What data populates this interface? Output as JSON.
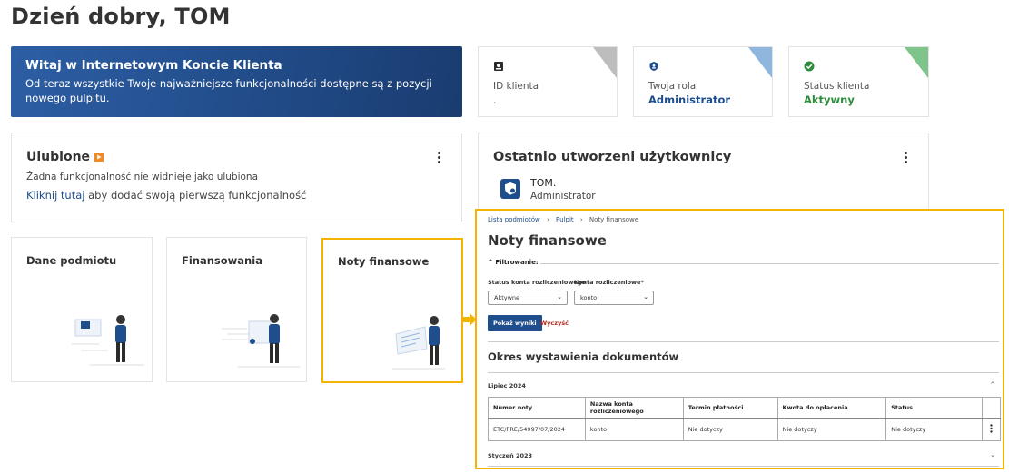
{
  "greeting": "Dzień dobry, TOM",
  "banner": {
    "title": "Witaj w Internetowym Koncie Klienta",
    "text": "Od teraz wszystkie Twoje najważniejsze funkcjonalności dostępne są z pozycji nowego pulpitu."
  },
  "stats": [
    {
      "label": "ID klienta",
      "value": ".",
      "icon": "badge-icon",
      "accent": "#bdbdbd"
    },
    {
      "label": "Twoja rola",
      "value": "Administrator",
      "icon": "shield-user-icon",
      "accent": "#8fb6dc",
      "value_color": "#1f4e8c"
    },
    {
      "label": "Status klienta",
      "value": "Aktywny",
      "icon": "check-circle-icon",
      "accent": "#7fc48a",
      "value_color": "#2e8b3d"
    }
  ],
  "favorites": {
    "title": "Ulubione",
    "empty_text": "Żadna funkcjonalność nie widnieje jako ulubiona",
    "link": "Kliknij tutaj",
    "link_suffix": " aby dodać swoją pierwszą funkcjonalność"
  },
  "recent_users": {
    "title": "Ostatnio utworzeni użytkownicy",
    "name": "TOM.",
    "role": "Administrator"
  },
  "tiles": [
    {
      "title": "Dane podmiotu"
    },
    {
      "title": "Finansowania"
    },
    {
      "title": "Noty finansowe"
    }
  ],
  "pane": {
    "breadcrumb": [
      "Lista podmiotów",
      "Pulpit",
      "Noty finansowe"
    ],
    "title": "Noty finansowe",
    "filter_heading": "Filtrowanie:",
    "filters": [
      {
        "label": "Status konta rozliczeniowego",
        "value": "Aktywne"
      },
      {
        "label": "Konta rozliczeniowe*",
        "value": "konto"
      }
    ],
    "show_button": "Pokaż wyniki",
    "clear_button": "Wyczyść",
    "period_title": "Okres wystawienia dokumentów",
    "groups": [
      "Lipiec 2024",
      "Styczeń 2023"
    ],
    "table": {
      "headers": [
        "Numer noty",
        "Nazwa konta rozliczeniowego",
        "Termin płatności",
        "Kwota do opłacenia",
        "Status"
      ],
      "rows": [
        [
          "ETC/PRE/54997/07/2024",
          "konto",
          "Nie dotyczy",
          "Nie dotyczy",
          "Nie dotyczy"
        ]
      ]
    }
  },
  "colors": {
    "highlight": "#f5b301",
    "brand": "#1f4e8c"
  }
}
